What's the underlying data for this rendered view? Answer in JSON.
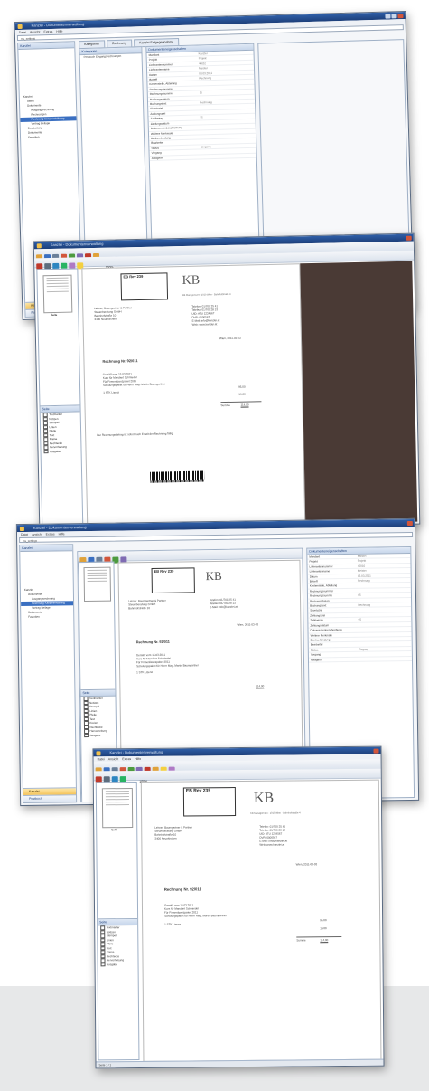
{
  "window": {
    "title": "Kanzlei - Dokumentenverwaltung",
    "menu": [
      "Datei",
      "Ansicht",
      "Extras",
      "Hilfe"
    ]
  },
  "addressbar": "ms_settings",
  "navigation": {
    "header": "Kanzlei",
    "buttons": [
      "Kanzlei",
      "Postbuch"
    ]
  },
  "tree": {
    "header": "Dokumente",
    "items": [
      "Kanzlei",
      "Akten",
      "Dokumente",
      "Ausgangsrechnung",
      "Rechnungen",
      "Rechnung Kanzleierklärung",
      "Vertrag Beilage",
      "Bearbeitung",
      "Dokumente",
      "Favoriten"
    ],
    "selected_index": 5
  },
  "tabs": [
    "Kategorien",
    "Rechnung",
    "Kanzlei Entgegennahme"
  ],
  "list": {
    "header": "Kategorien",
    "items": [
      "Postbuch Eingangsrechnungen"
    ]
  },
  "properties": {
    "header": "Dokumenteneigenschaften",
    "rows": [
      {
        "label": "Mandant",
        "value": "Kanzlei"
      },
      {
        "label": "Projekt",
        "value": "Projekt"
      },
      {
        "label": "Lieferantennummer",
        "value": "40010"
      },
      {
        "label": "Lieferantenname",
        "value": "Meister"
      },
      {
        "label": "Datum",
        "value": "03.03.2011"
      },
      {
        "label": "Betreff",
        "value": "Rechnung"
      },
      {
        "label": "Kostenstelle, Abteilung",
        "value": ""
      },
      {
        "label": "Rechnungsnummer",
        "value": ""
      },
      {
        "label": "Rechnungssumme",
        "value": "95"
      },
      {
        "label": "Buchungsdatum",
        "value": ""
      },
      {
        "label": "Buchungstext",
        "value": "Rechnung"
      },
      {
        "label": "Skontoziel",
        "value": ""
      },
      {
        "label": "Zahlungsziel",
        "value": ""
      },
      {
        "label": "Zahlbetrag",
        "value": "95"
      },
      {
        "label": "Zahlungsdatum",
        "value": ""
      },
      {
        "label": "Dokumentenbeschreibung",
        "value": ""
      },
      {
        "label": "Weitere Merkmale",
        "value": ""
      },
      {
        "label": "Bankverbindung",
        "value": ""
      },
      {
        "label": "Bearbeiter",
        "value": ""
      },
      {
        "label": "Status",
        "value": "Eingang"
      },
      {
        "label": "Vorgang",
        "value": ""
      },
      {
        "label": "Ablageort",
        "value": ""
      }
    ]
  },
  "viewer": {
    "search_label": "Suche",
    "zoom": "100%",
    "thumbnail_label": "Seite",
    "layer_header": "Seite",
    "layer_items": [
      "Textmarker",
      "Notizen",
      "Stempel",
      "Linien",
      "Pfeile",
      "Text",
      "Kreise",
      "Rechtecke",
      "Hervorhebung",
      "Ausgabe"
    ],
    "status": "Seite 1 / 1"
  },
  "invoice": {
    "stamp_text": "EB Rev 239",
    "logo": "KB",
    "sender_line": "KB Management · 1010 Wien · Bahnhofstraße 4",
    "recipient": [
      "Lehner, Baumgartner & Partner",
      "Steuerberatung GmbH",
      "Bahnhofstraße 10",
      "3400 Neunkirchen"
    ],
    "contact": [
      "Telefon: 01/700 25 41",
      "Telefax: 01/700 28 13",
      "UID: ATU 1234567",
      "DVR: 0000567",
      "E-Mail: info@kanzlei.at",
      "Web: www.kanzlei.at"
    ],
    "date_line": "Wien, 2011-03-03",
    "title": "Rechnung Nr. 92/011",
    "body": [
      "Gemäß vom 15.03.2011",
      "Kurs für Mandant Schmiedel",
      "Für Firmenlizenzpaket 2011",
      "Schulungspaket für Herrn Mag. Martin Baumgartner"
    ],
    "item": "1 STK Lizenz",
    "amount_1": "95,00",
    "amount_2": "19,00",
    "total_label": "Summe",
    "total": "114,00",
    "footer": "Der Rechnungsbetrag ist sofort nach Erhalt der Rechnung fällig."
  },
  "colors": {
    "accent": "#1d3f7a",
    "selection": "#3a6fc1",
    "nav_active": "#f5c45a",
    "dark_area": "#4a3a35"
  }
}
